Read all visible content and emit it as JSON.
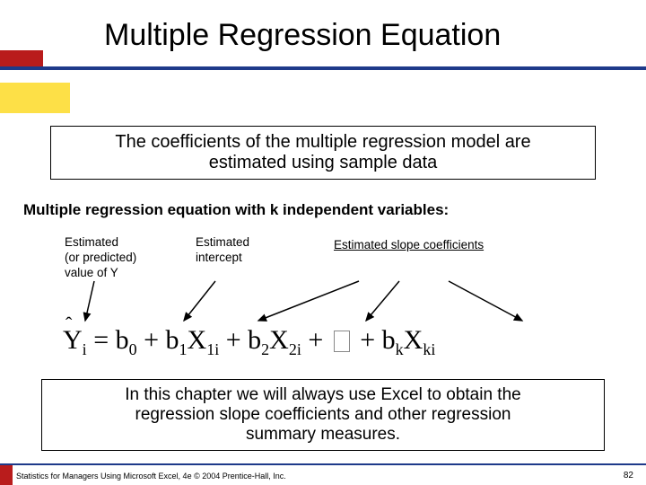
{
  "title": "Multiple Regression Equation",
  "box1_line1": "The coefficients of the multiple regression model are",
  "box1_line2": "estimated using sample data",
  "subheading": "Multiple regression equation with k independent variables:",
  "labels": {
    "l1a": "Estimated",
    "l1b": "(or predicted)",
    "l1c": "value of Y",
    "l2a": "Estimated",
    "l2b": "intercept",
    "l3": "Estimated slope coefficients"
  },
  "equation": {
    "lhs": "Y",
    "sub_i": "i",
    "eq": " = b",
    "s0": "0",
    "p": " + b",
    "s1": "1",
    "x": "X",
    "s1i": "1i",
    "s2": "2",
    "s2i": "2i",
    "sk": "k",
    "ski": "ki"
  },
  "box2_line1": "In this chapter we will always use Excel to obtain the",
  "box2_line2": "regression slope coefficients and other regression",
  "box2_line3": "summary measures.",
  "footer": "Statistics for Managers Using Microsoft Excel, 4e © 2004 Prentice-Hall, Inc.",
  "page": "82"
}
